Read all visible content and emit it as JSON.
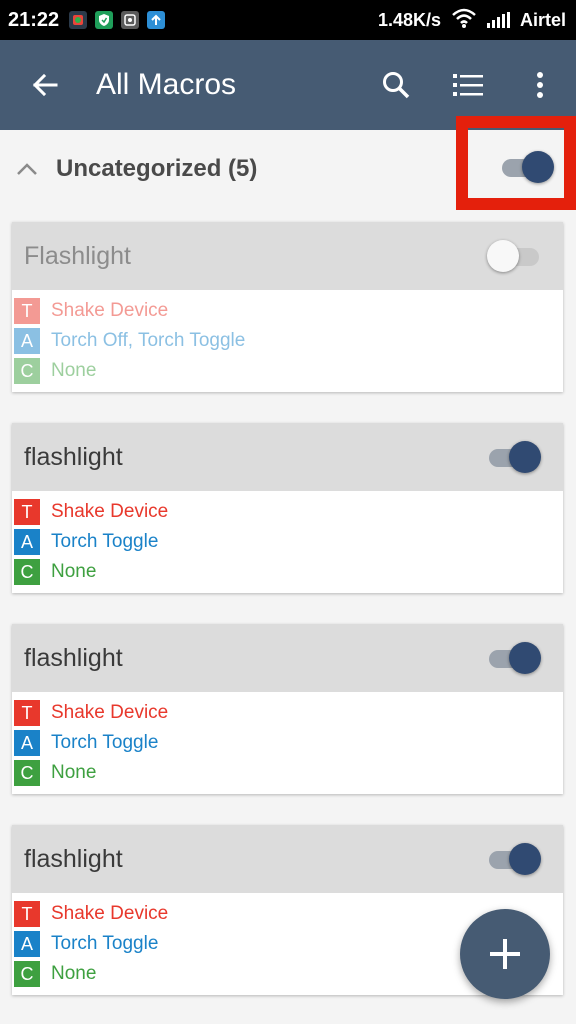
{
  "status_bar": {
    "time": "21:22",
    "net_speed": "1.48K/s",
    "carrier": "Airtel",
    "icons": [
      "app-notification-icon",
      "shield-icon",
      "gallery-icon",
      "upload-icon",
      "wifi-icon",
      "signal-icon"
    ]
  },
  "app_bar": {
    "title": "All Macros",
    "back_icon": "arrow-back-icon",
    "search_icon": "search-icon",
    "list_icon": "list-icon",
    "menu_icon": "more-vert-icon"
  },
  "category": {
    "title": "Uncategorized (5)",
    "enabled": true
  },
  "macros": [
    {
      "name": "Flashlight",
      "enabled": false,
      "trigger": "Shake Device",
      "action": "Torch Off, Torch Toggle",
      "constraint": "None"
    },
    {
      "name": "flashlight",
      "enabled": true,
      "trigger": "Shake Device",
      "action": "Torch Toggle",
      "constraint": "None"
    },
    {
      "name": "flashlight",
      "enabled": true,
      "trigger": "Shake Device",
      "action": "Torch Toggle",
      "constraint": "None"
    },
    {
      "name": "flashlight",
      "enabled": true,
      "trigger": "Shake Device",
      "action": "Torch Toggle",
      "constraint": "None"
    }
  ],
  "badges": {
    "trigger": "T",
    "action": "A",
    "constraint": "C"
  },
  "colors": {
    "app_bar": "#465b73",
    "toggle_on": "#304a72",
    "trigger": "#e8382c",
    "action": "#1a82c8",
    "constraint": "#3ea040",
    "highlight": "#e4200c"
  },
  "fab": {
    "icon": "plus-icon"
  }
}
